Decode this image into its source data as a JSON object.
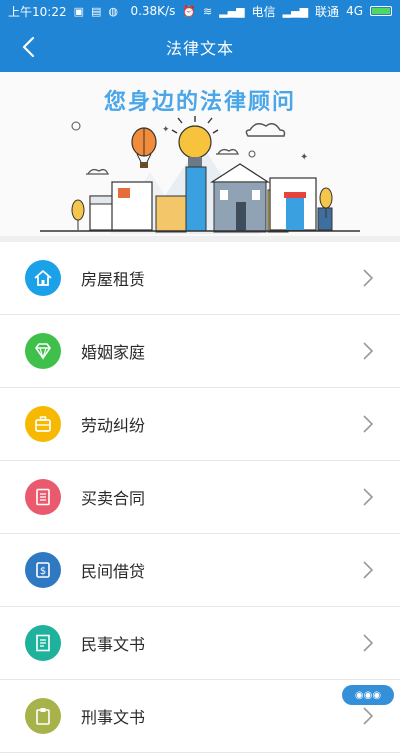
{
  "status_bar": {
    "time": "上午10:22",
    "speed": "0.38K/s",
    "carrier1": "电信",
    "carrier2": "联通",
    "network": "4G"
  },
  "app_bar": {
    "title": "法律文本",
    "back_icon": "chevron-left-icon"
  },
  "banner": {
    "slogan": "您身边的法律顾问"
  },
  "list": [
    {
      "label": "房屋租赁",
      "icon": "house-icon",
      "color": "#1aa1e8"
    },
    {
      "label": "婚姻家庭",
      "icon": "diamond-icon",
      "color": "#3ec04a"
    },
    {
      "label": "劳动纠纷",
      "icon": "briefcase-icon",
      "color": "#f6b800"
    },
    {
      "label": "买卖合同",
      "icon": "document-icon",
      "color": "#ea5a6e"
    },
    {
      "label": "民间借贷",
      "icon": "money-bag-icon",
      "color": "#2f79c3"
    },
    {
      "label": "民事文书",
      "icon": "form-icon",
      "color": "#1eb19b"
    },
    {
      "label": "刑事文书",
      "icon": "clipboard-icon",
      "color": "#a8b24a"
    }
  ],
  "colors": {
    "primary": "#1f85d4",
    "divider": "#e6e6e6"
  }
}
